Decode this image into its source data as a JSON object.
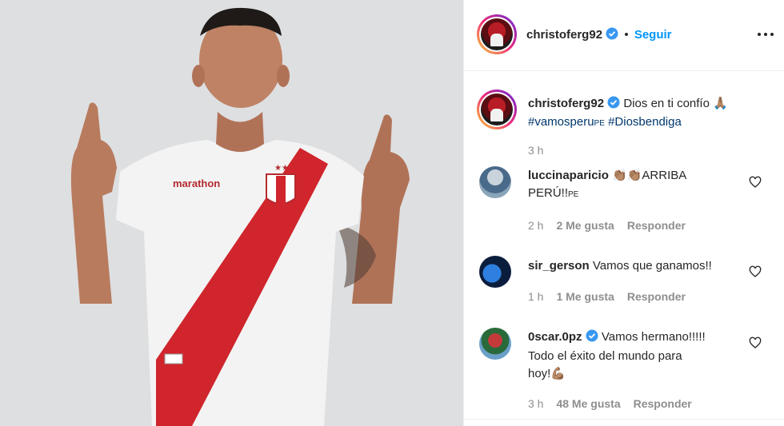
{
  "photo": {
    "alt_icon": "person-photo",
    "shirt_brand": "marathon",
    "crest": "FPF"
  },
  "header": {
    "username": "christoferg92",
    "separator": "•",
    "follow_label": "Seguir"
  },
  "caption": {
    "username": "christoferg92",
    "text": "Dios en ti confío",
    "emoji": "🙏🏽",
    "hashtag1": "#vamosperu",
    "hashtag1_suffix": "PE",
    "hashtag2": "#Diosbendiga",
    "time": "3 h"
  },
  "comments": [
    {
      "username": "luccinaparicio",
      "text_line1": "👏🏽👏🏽ARRIBA",
      "text_line2": "PERÚ!!",
      "text_suffix": "PE",
      "time": "2 h",
      "likes": "2 Me gusta",
      "reply": "Responder"
    },
    {
      "username": "sir_gerson",
      "text": "Vamos que ganamos!!",
      "time": "1 h",
      "likes": "1 Me gusta",
      "reply": "Responder"
    },
    {
      "username": "0scar.0pz",
      "text_line1": "Vamos hermano!!!!!",
      "text_line2": "Todo el éxito del mundo para",
      "text_line3": "hoy!💪🏽",
      "time": "3 h",
      "likes": "48 Me gusta",
      "reply": "Responder"
    }
  ],
  "colors": {
    "link": "#0095f6",
    "hashtag": "#00376b",
    "muted": "#8e8e8e",
    "text": "#262626",
    "verified": "#3897f0"
  }
}
